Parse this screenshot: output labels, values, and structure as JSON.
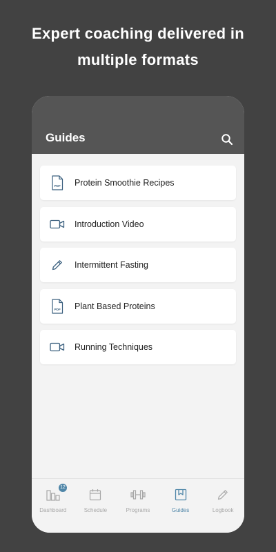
{
  "headline": {
    "line1": "Expert coaching delivered in",
    "line2": "multiple formats"
  },
  "header": {
    "title": "Guides",
    "search_icon": "search-icon"
  },
  "guides": [
    {
      "label": "Protein Smoothie Recipes",
      "icon": "pdf-icon",
      "icon_text": "PDF"
    },
    {
      "label": "Introduction Video",
      "icon": "video-icon"
    },
    {
      "label": "Intermittent Fasting",
      "icon": "pencil-icon"
    },
    {
      "label": "Plant Based Proteins",
      "icon": "pdf-icon",
      "icon_text": "PDF"
    },
    {
      "label": "Running Techniques",
      "icon": "video-icon"
    }
  ],
  "tabbar": {
    "items": [
      {
        "label": "Dashboard",
        "icon": "bar-chart-icon",
        "badge": "12"
      },
      {
        "label": "Schedule",
        "icon": "calendar-icon"
      },
      {
        "label": "Programs",
        "icon": "dumbbell-icon"
      },
      {
        "label": "Guides",
        "icon": "bookmark-icon",
        "active": true
      },
      {
        "label": "Logbook",
        "icon": "pencil-icon"
      }
    ]
  },
  "colors": {
    "background": "#424242",
    "header": "#555555",
    "accent": "#4f86a8",
    "icon": "#3a5f7e",
    "inactive": "#a7a7a7"
  }
}
